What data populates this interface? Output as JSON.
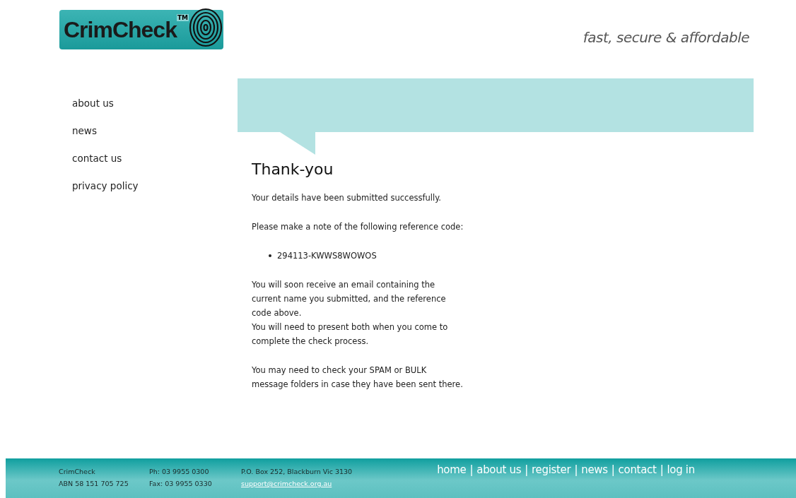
{
  "header": {
    "logo": {
      "name": "CrimCheck",
      "mark": "TM"
    },
    "tagline": "fast, secure & affordable"
  },
  "sidebar": {
    "items": [
      {
        "label": "about us"
      },
      {
        "label": "news"
      },
      {
        "label": "contact us"
      },
      {
        "label": "privacy policy"
      }
    ]
  },
  "content": {
    "title": "Thank-you",
    "blocks": [
      {
        "kind": "paragraph",
        "text": "Your details have been submitted successfully."
      },
      {
        "kind": "paragraph",
        "text": "Please make a note of the following reference code:"
      },
      {
        "kind": "bullet",
        "text": "294113-KWWS8WOWOS"
      },
      {
        "kind": "paragraph",
        "text": "You will soon receive an email containing the\ncurrent name you submitted, and the reference\ncode above.\nYou will need to present both when you come to\ncomplete the check process."
      },
      {
        "kind": "paragraph",
        "text": "You may need to check your SPAM or BULK\nmessage folders in case they have been sent there."
      }
    ]
  },
  "footer": {
    "columns": [
      {
        "lines": [
          {
            "kind": "text",
            "text": "CrimCheck"
          },
          {
            "kind": "text",
            "text": "ABN 58 151 705 725"
          }
        ]
      },
      {
        "lines": [
          {
            "kind": "text",
            "text": "Ph: 03 9955 0300"
          },
          {
            "kind": "text",
            "text": "Fax: 03 9955 0330"
          }
        ]
      },
      {
        "lines": [
          {
            "kind": "text",
            "text": "P.O. Box 252, Blackburn Vic 3130"
          },
          {
            "kind": "link",
            "text": "support@crimcheck.org.au"
          }
        ]
      }
    ],
    "separator": "|",
    "nav": [
      {
        "label": "home"
      },
      {
        "label": "about us"
      },
      {
        "label": "register"
      },
      {
        "label": "news"
      },
      {
        "label": "contact"
      },
      {
        "label": "log in"
      }
    ]
  }
}
